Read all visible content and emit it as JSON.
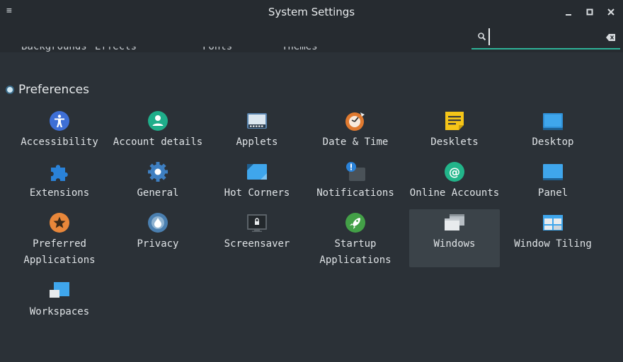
{
  "window": {
    "title": "System Settings",
    "menu_icon": "hamburger-menu-icon",
    "minimize": "minimize-icon",
    "maximize": "maximize-icon",
    "close": "close-icon"
  },
  "search": {
    "value": "",
    "placeholder": ""
  },
  "cutoff_items": [
    "Backgrounds",
    "Effects",
    "Fonts",
    "Themes"
  ],
  "section": {
    "title": "Preferences"
  },
  "items": [
    {
      "label": "Accessibility",
      "icon": "accessibility-icon"
    },
    {
      "label": "Account details",
      "icon": "account-details-icon"
    },
    {
      "label": "Applets",
      "icon": "applets-icon"
    },
    {
      "label": "Date & Time",
      "icon": "date-time-icon"
    },
    {
      "label": "Desklets",
      "icon": "desklets-icon"
    },
    {
      "label": "Desktop",
      "icon": "desktop-icon"
    },
    {
      "label": "Extensions",
      "icon": "extensions-icon"
    },
    {
      "label": "General",
      "icon": "general-icon"
    },
    {
      "label": "Hot Corners",
      "icon": "hot-corners-icon"
    },
    {
      "label": "Notifications",
      "icon": "notifications-icon"
    },
    {
      "label": "Online Accounts",
      "icon": "online-accounts-icon"
    },
    {
      "label": "Panel",
      "icon": "panel-icon"
    },
    {
      "label": "Preferred\nApplications",
      "icon": "preferred-applications-icon"
    },
    {
      "label": "Privacy",
      "icon": "privacy-icon"
    },
    {
      "label": "Screensaver",
      "icon": "screensaver-icon"
    },
    {
      "label": "Startup\nApplications",
      "icon": "startup-applications-icon"
    },
    {
      "label": "Windows",
      "icon": "windows-icon"
    },
    {
      "label": "Window Tiling",
      "icon": "window-tiling-icon"
    },
    {
      "label": "Workspaces",
      "icon": "workspaces-icon"
    }
  ],
  "selected_item": "Windows",
  "colors": {
    "background": "#2b3137",
    "titlebar": "#262b30",
    "accent": "#2eb398",
    "selected": "#3b4349"
  }
}
